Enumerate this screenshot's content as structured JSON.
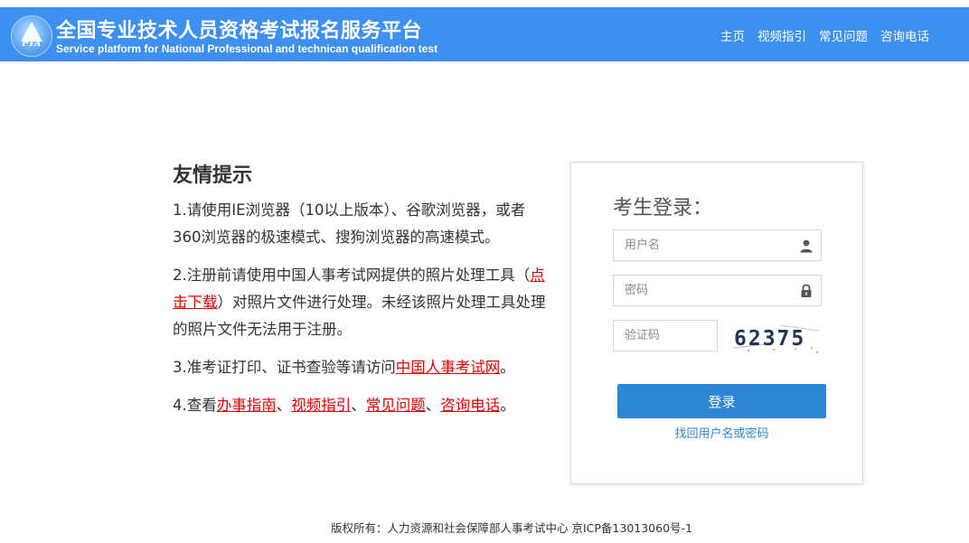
{
  "header": {
    "logo_text": "PTA",
    "title": "全国专业技术人员资格考试报名服务平台",
    "subtitle": "Service platform for National Professional and technican qualification test",
    "nav": [
      "主页",
      "视频指引",
      "常见问题",
      "咨询电话"
    ],
    "bg_color": "#3d8ff0"
  },
  "tips": {
    "title": "友情提示",
    "tip1": "1.请使用IE浏览器（10以上版本）、谷歌浏览器，或者360浏览器的极速模式、搜狗浏览器的高速模式。",
    "tip2_before": "2.注册前请使用中国人事考试网提供的照片处理工具（",
    "tip2_link": "点击下载",
    "tip2_after": "）对照片文件进行处理。未经该照片处理工具处理的照片文件无法用于注册。",
    "tip3_before": "3.准考证打印、证书查验等请访问",
    "tip3_link": "中国人事考试网",
    "tip3_after": "。",
    "tip4_before": "4.查看",
    "tip4_links": [
      "办事指南",
      "视频指引",
      "常见问题",
      "咨询电话"
    ],
    "tip4_sep": "、",
    "tip4_after": "。",
    "link_color": "#e00000"
  },
  "login": {
    "title": "考生登录：",
    "username_placeholder": "用户名",
    "password_placeholder": "密码",
    "captcha_placeholder": "验证码",
    "captcha_code": "62375",
    "submit_label": "登录",
    "forgot_label": "找回用户名或密码",
    "accent_color": "#2d86d3"
  },
  "footer": {
    "text": "版权所有：人力资源和社会保障部人事考试中心 京ICP备13013060号-1"
  }
}
